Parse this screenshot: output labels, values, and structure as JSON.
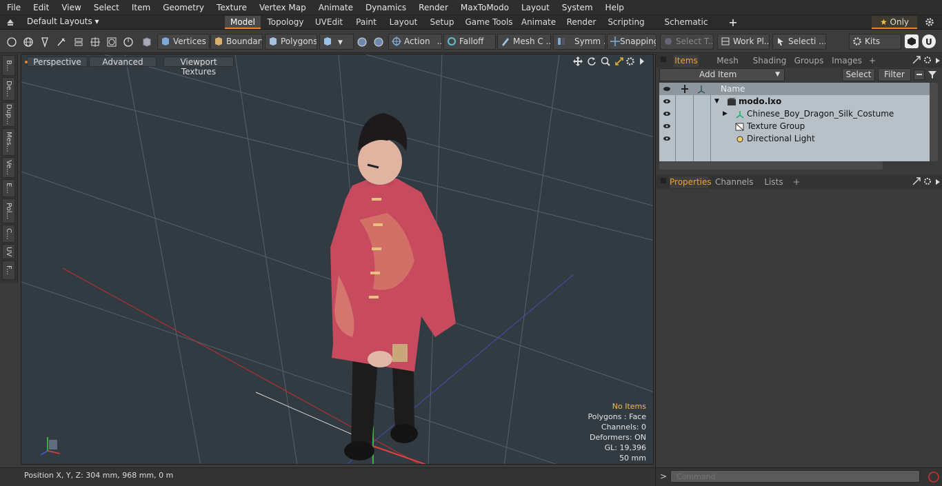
{
  "menu": [
    "File",
    "Edit",
    "View",
    "Select",
    "Item",
    "Geometry",
    "Texture",
    "Vertex Map",
    "Animate",
    "Dynamics",
    "Render",
    "MaxToModo",
    "Layout",
    "System",
    "Help"
  ],
  "layouts": {
    "label": "Default Layouts ▾",
    "tabs": [
      "Model",
      "Topology",
      "UVEdit",
      "Paint",
      "Layout",
      "Setup",
      "Game Tools",
      "Animate",
      "Render",
      "Scripting",
      "Schematic Fusion"
    ],
    "active": "Model",
    "add": "+",
    "only_label": "Only"
  },
  "toolbar": {
    "vertices": "Vertices",
    "boundary": "Boundary",
    "polygons": "Polygons",
    "action": "Action",
    "falloff": "Falloff",
    "mesh": "Mesh C ...",
    "symm": "Symm ...",
    "snapping": "Snapping",
    "select_t": "Select T...",
    "workplane": "Work Pl...",
    "selecti": "Selecti ...",
    "kits": "Kits"
  },
  "lefttabs": [
    "B...",
    "De...",
    "Dup...",
    "Mes...",
    "Ve...",
    "E...",
    "Pol...",
    "C...",
    "UV",
    "F..."
  ],
  "viewport": {
    "perspective": "Perspective",
    "advanced": "Advanced",
    "viewport_textures": "Viewport Textures",
    "info": {
      "no_items": "No Items",
      "polygons": "Polygons : Face",
      "channels": "Channels: 0",
      "deformers": "Deformers: ON",
      "gl": "GL: 19,396",
      "size": "50 mm"
    }
  },
  "status": {
    "position": "Position X, Y, Z:   304 mm, 968 mm, 0 m"
  },
  "items_panel": {
    "tabs": [
      "Items",
      "Mesh Ops",
      "Shading",
      "Groups",
      "Images"
    ],
    "active": "Items",
    "add_item": "Add Item",
    "select": "Select",
    "filter": "Filter",
    "name_header": "Name",
    "rows": [
      {
        "label": "modo.lxo"
      },
      {
        "label": "Chinese_Boy_Dragon_Silk_Costume"
      },
      {
        "label": "Texture Group"
      },
      {
        "label": "Directional Light"
      }
    ]
  },
  "props_panel": {
    "tabs": [
      "Properties",
      "Channels",
      "Lists"
    ],
    "active": "Properties"
  },
  "command": {
    "placeholder": "Command"
  },
  "colors": {
    "accent": "#e88a2a",
    "viewport_bg": "#323b42",
    "list_bg": "#b8c1c8"
  }
}
